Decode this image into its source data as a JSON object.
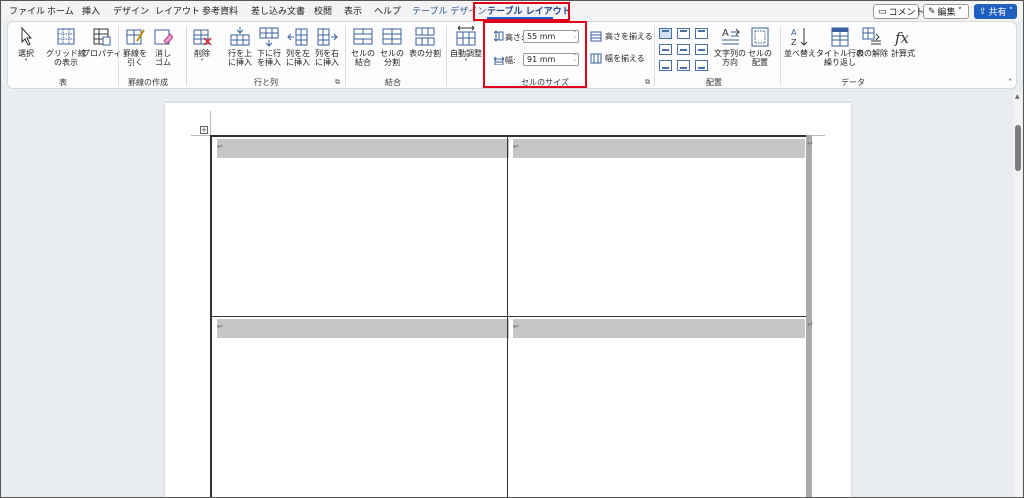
{
  "tabs": [
    {
      "label": "ファイル",
      "active": false
    },
    {
      "label": "ホーム",
      "active": false
    },
    {
      "label": "挿入",
      "active": false
    },
    {
      "label": "デザイン",
      "active": false
    },
    {
      "label": "レイアウト",
      "active": false
    },
    {
      "label": "参考資料",
      "active": false
    },
    {
      "label": "差し込み文書",
      "active": false
    },
    {
      "label": "校閲",
      "active": false
    },
    {
      "label": "表示",
      "active": false
    },
    {
      "label": "ヘルプ",
      "active": false
    },
    {
      "label": "テーブル デザイン",
      "active": false
    },
    {
      "label": "テーブル レイアウト",
      "active": true
    }
  ],
  "top_right": {
    "comment": "コメント",
    "edit": "編集",
    "share": "共有"
  },
  "ribbon": {
    "table": {
      "select": "選択",
      "gridlines_1": "グリッド線",
      "gridlines_2": "の表示",
      "properties": "プロパティ",
      "group": "表"
    },
    "draw": {
      "draw_1": "罫線を",
      "draw_2": "引く",
      "eraser_1": "消し",
      "eraser_2": "ゴム",
      "group": "罫線の作成"
    },
    "rows_cols": {
      "delete": "削除",
      "insert_above_1": "行を上",
      "insert_above_2": "に挿入",
      "insert_below_1": "下に行",
      "insert_below_2": "を挿入",
      "insert_left_1": "列を左",
      "insert_left_2": "に挿入",
      "insert_right_1": "列を右",
      "insert_right_2": "に挿入",
      "group": "行と列"
    },
    "merge": {
      "merge_1": "セルの",
      "merge_2": "結合",
      "split_1": "セルの",
      "split_2": "分割",
      "split_table": "表の分割",
      "group": "結合"
    },
    "cell_size": {
      "autofit": "自動調整",
      "height_label": "高さ:",
      "height_value": "55 mm",
      "width_label": "幅:",
      "width_value": "91 mm",
      "distribute_rows": "高さを揃える",
      "distribute_cols": "幅を揃える",
      "group": "セルのサイズ"
    },
    "alignment": {
      "direction_1": "文字列の",
      "direction_2": "方向",
      "margins_1": "セルの",
      "margins_2": "配置",
      "group": "配置"
    },
    "data": {
      "sort": "並べ替え",
      "repeat_1": "タイトル行の",
      "repeat_2": "繰り返し",
      "convert": "表の解除",
      "formula": "計算式",
      "group": "データ"
    }
  },
  "doc": {
    "para_mark": "↵"
  },
  "colors": {
    "accent": "#1d5ac8",
    "highlight": "#e0001b",
    "share": "#1f5fbf"
  }
}
